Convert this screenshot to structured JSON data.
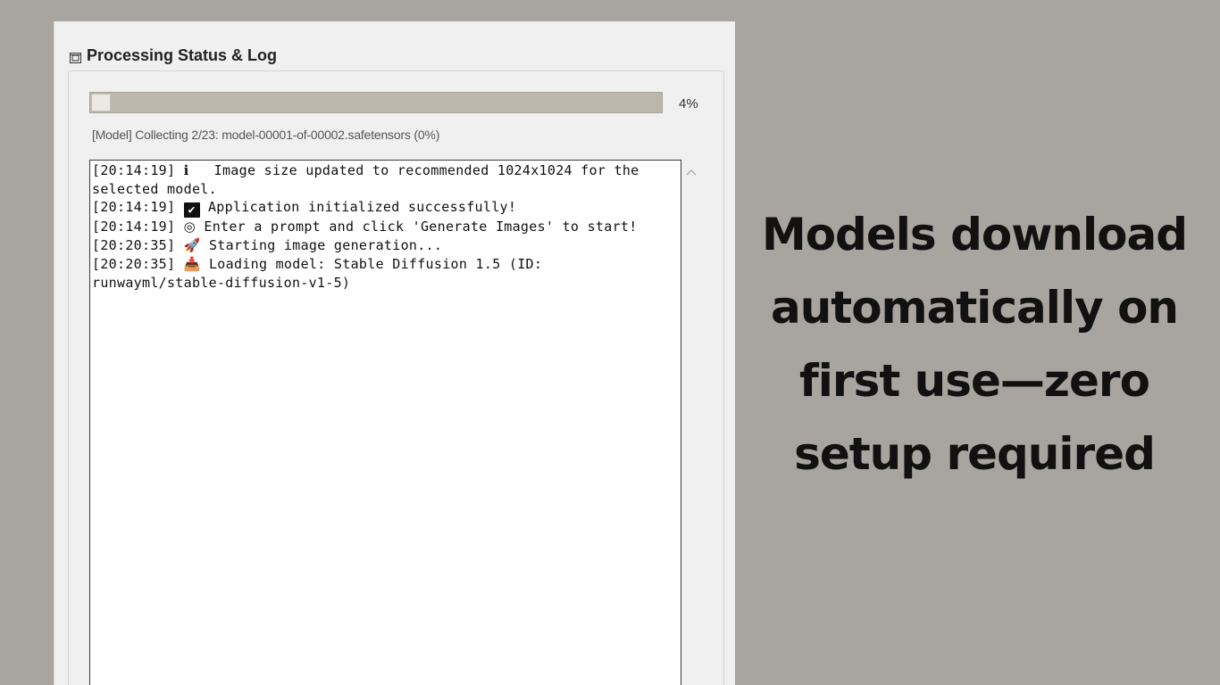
{
  "panel": {
    "title": "Processing Status & Log",
    "icon": "collapse-toggle-icon"
  },
  "progress": {
    "value": 0.04,
    "percent_label": "4%"
  },
  "status_text": "[Model] Collecting 2/23: model-00001-of-00002.safetensors (0%)",
  "log": [
    {
      "time": "[20:14:19]",
      "icon": "info-icon",
      "glyph": "ℹ",
      "text": "Image size updated to recommended 1024x1024 for the selected model."
    },
    {
      "time": "[20:14:19]",
      "icon": "check-icon",
      "glyph": "✔",
      "text": "Application initialized successfully!"
    },
    {
      "time": "[20:14:19]",
      "icon": "target-icon",
      "glyph": "◎",
      "text": "Enter a prompt and click 'Generate Images' to start!"
    },
    {
      "time": "[20:20:35]",
      "icon": "rocket-icon",
      "glyph": "🚀",
      "text": "Starting image generation..."
    },
    {
      "time": "[20:20:35]",
      "icon": "download-icon",
      "glyph": "📥",
      "text": "Loading model: Stable Diffusion 1.5 (ID: runwayml/stable-diffusion-v1-5)"
    }
  ],
  "caption": "Models download automatically on first use—zero setup required",
  "colors": {
    "background": "#a8a4a0",
    "panel": "#f0f0f0",
    "progress_track": "#bcb7ac",
    "log_background": "#ffffff"
  }
}
